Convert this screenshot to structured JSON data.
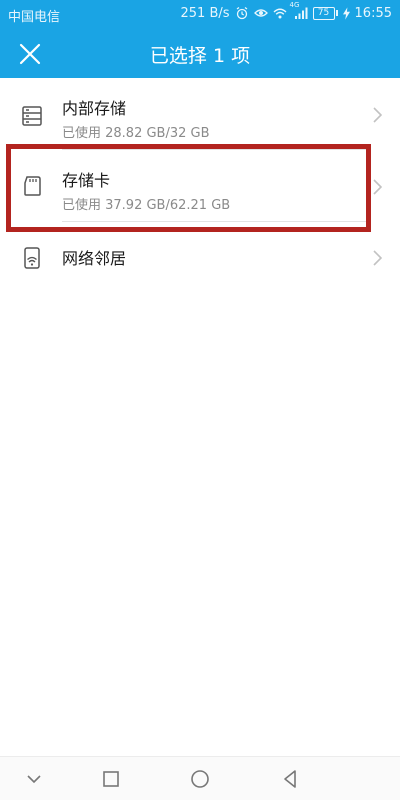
{
  "status_bar": {
    "carrier": "中国电信",
    "speed": "251 B/s",
    "network_badge": "4G",
    "battery": "75",
    "time": "16:55"
  },
  "header": {
    "title": "已选择 1 项",
    "background": "#1aa4e4"
  },
  "storage": {
    "internal": {
      "label": "内部存储",
      "usage": "已使用 28.82 GB/32 GB",
      "icon": "server-storage-icon"
    },
    "sd_card": {
      "label": "存储卡",
      "usage": "已使用 37.92 GB/62.21 GB",
      "icon": "sd-card-icon"
    },
    "network": {
      "label": "网络邻居",
      "icon": "network-device-icon"
    }
  },
  "highlight_color": "#b3241f",
  "nav": {
    "icons": [
      "chevron-down-icon",
      "square-icon",
      "circle-icon",
      "triangle-back-icon"
    ]
  }
}
